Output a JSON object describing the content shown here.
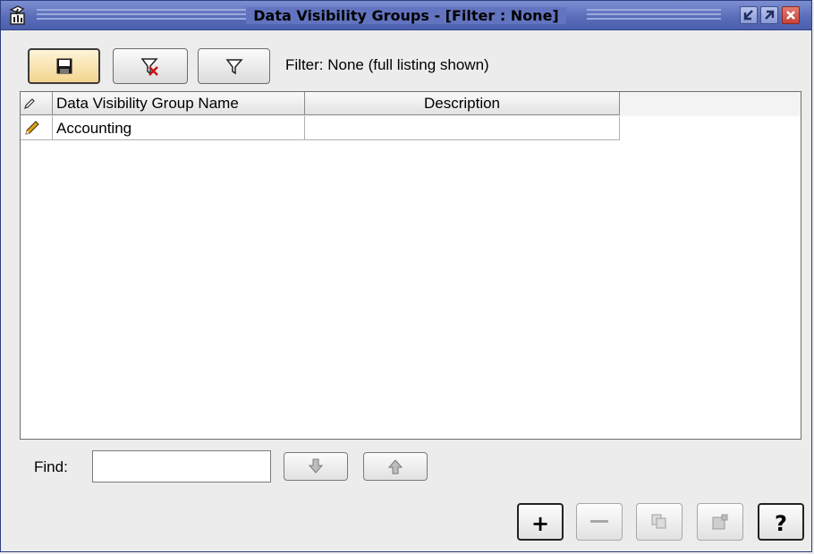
{
  "window": {
    "title": "Data Visibility Groups - [Filter : None]"
  },
  "toolbar": {
    "filter_status": "Filter: None (full listing shown)",
    "buttons": [
      {
        "name": "save-button",
        "icon": "floppy-disk-icon",
        "active": true
      },
      {
        "name": "clear-filter-button",
        "icon": "funnel-clear-icon"
      },
      {
        "name": "filter-button",
        "icon": "funnel-icon"
      }
    ]
  },
  "table": {
    "columns": [
      "Data Visibility Group Name",
      "Description"
    ],
    "rows": [
      {
        "name": "Accounting",
        "description": "",
        "editing": true
      }
    ]
  },
  "find": {
    "label": "Find:",
    "value": "",
    "placeholder": ""
  },
  "actions": {
    "add_label": "+",
    "help_label": "?"
  },
  "colors": {
    "titlebar": "#5a6db9",
    "background": "#ececec",
    "active_button": "#f2d48e",
    "close_button": "#c5433a"
  }
}
